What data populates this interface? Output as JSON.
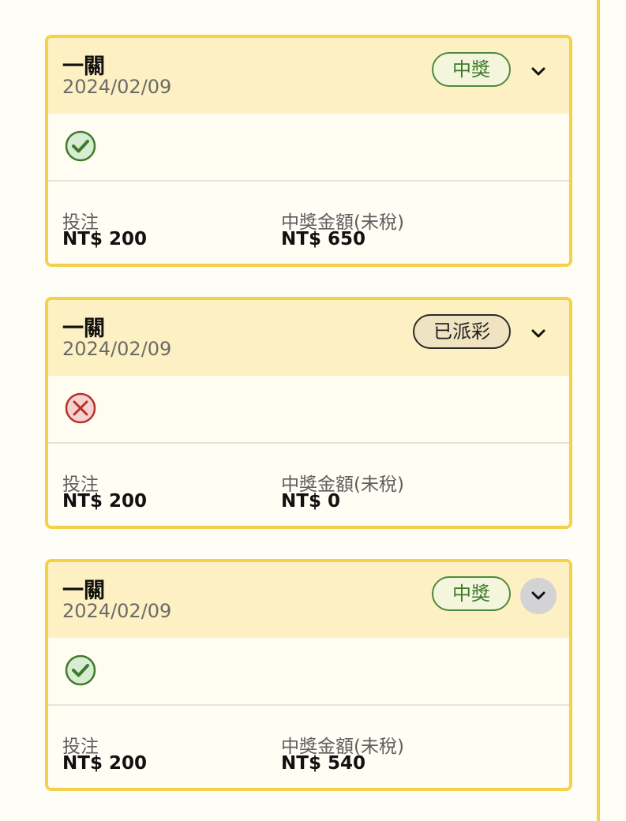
{
  "bets": [
    {
      "title": "一關",
      "date": "2024/02/09",
      "status": "中獎",
      "status_type": "win",
      "result_icon": "check-circle-icon",
      "stake_label": "投注",
      "stake_value": "NT$ 200",
      "prize_label": "中獎金額(未稅)",
      "prize_value": "NT$ 650"
    },
    {
      "title": "一關",
      "date": "2024/02/09",
      "status": "已派彩",
      "status_type": "paid",
      "result_icon": "x-circle-icon",
      "stake_label": "投注",
      "stake_value": "NT$ 200",
      "prize_label": "中獎金額(未稅)",
      "prize_value": "NT$ 0"
    },
    {
      "title": "一關",
      "date": "2024/02/09",
      "status": "中獎",
      "status_type": "win",
      "result_icon": "check-circle-icon",
      "stake_label": "投注",
      "stake_value": "NT$ 200",
      "prize_label": "中獎金額(未稅)",
      "prize_value": "NT$ 540"
    }
  ],
  "colors": {
    "card_border": "#f3d24a",
    "header_bg": "#fdf0c2",
    "win": "#3d7b2c",
    "loss": "#c0392b"
  }
}
